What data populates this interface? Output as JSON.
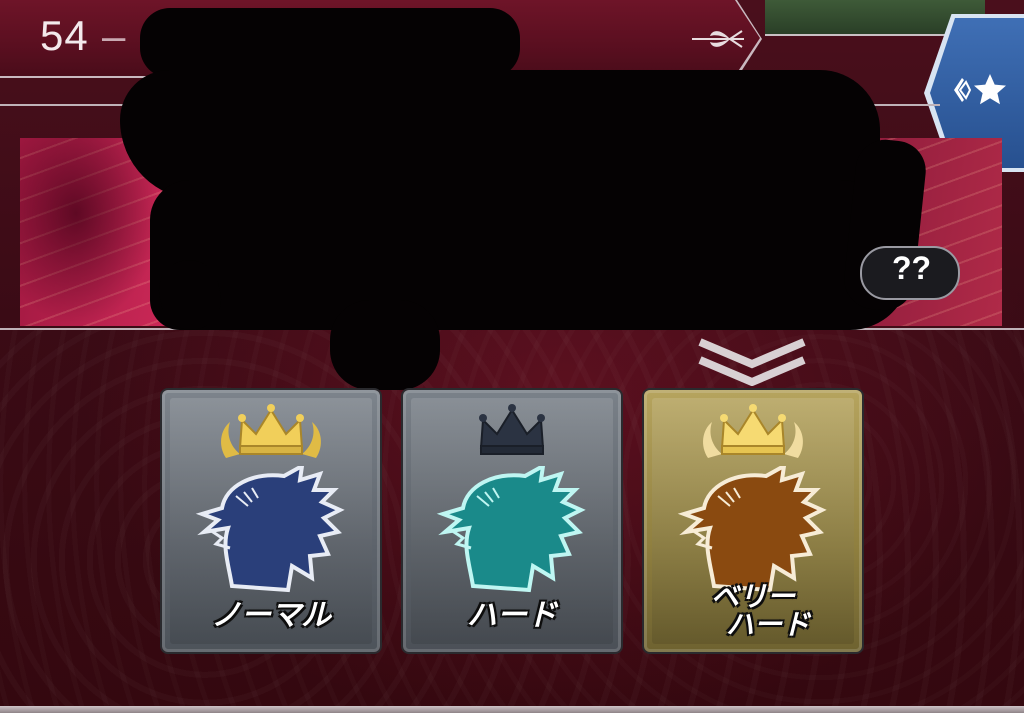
{
  "header": {
    "level_number": "54",
    "separator": "–"
  },
  "banner": {
    "hint_badge": "??"
  },
  "difficulties": [
    {
      "label": "ノーマル",
      "crown": "gold-crown",
      "beast_color": "#2a3f7a",
      "selected": false
    },
    {
      "label": "ハード",
      "crown": "dark-crown",
      "beast_color": "#1a8a8a",
      "selected": false
    },
    {
      "label_line1": "ベリー",
      "label_line2": "ハード",
      "crown": "gold-crown",
      "beast_color": "#8a4a10",
      "selected": true
    }
  ],
  "colors": {
    "gold": "#e8c34a",
    "dark_crown": "#2b3342",
    "accent_blue": "#3f6fb5"
  }
}
